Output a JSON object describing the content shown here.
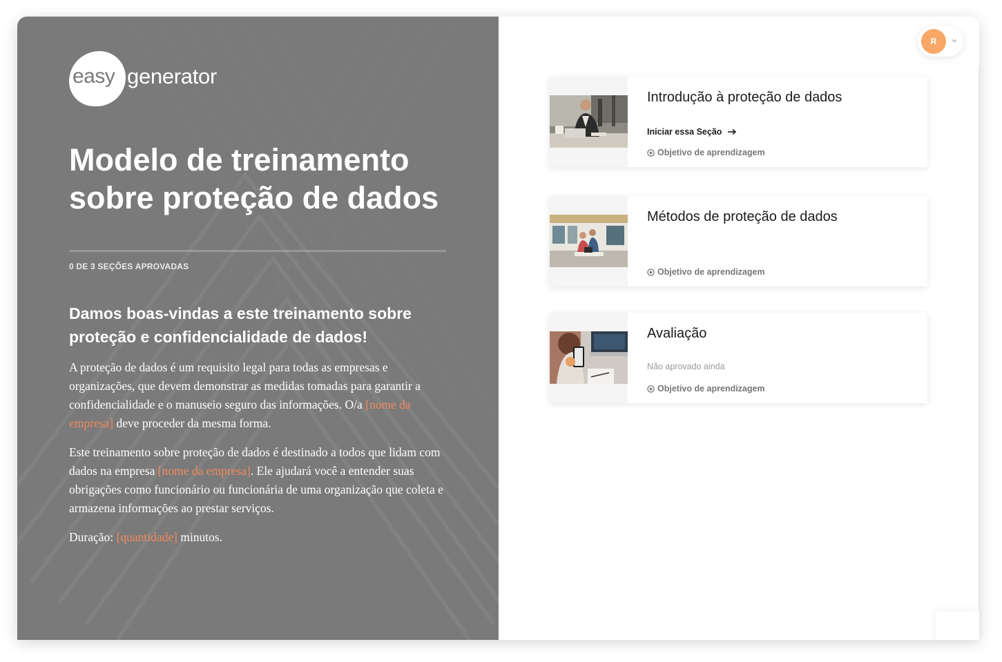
{
  "brand": {
    "logo_easy": "easy",
    "logo_generator": "generator"
  },
  "course": {
    "title": "Modelo de treinamento sobre proteção de dados",
    "progress_text": "0 DE 3 SEÇÕES APROVADAS",
    "progress_fraction": 0,
    "welcome_heading": "Damos boas-vindas a este treinamento sobre proteção e confidencialidade de dados!",
    "paragraphs": [
      [
        {
          "text": "A proteção de dados é um requisito legal para todas as empresas e organizações, que devem demonstrar as medidas tomadas para garantir a confidencialidade e o manuseio seguro das informações. O/a "
        },
        {
          "text": "[nome da empresa]",
          "highlight": true
        },
        {
          "text": " deve proceder da mesma forma."
        }
      ],
      [
        {
          "text": "Este treinamento sobre proteção de dados é destinado a todos que lidam com dados na empresa "
        },
        {
          "text": "[nome da empresa]",
          "highlight": true
        },
        {
          "text": ". Ele ajudará você a entender suas obrigações como funcionário ou funcionária de uma organização que coleta e armazena informações ao prestar serviços."
        }
      ],
      [
        {
          "text": "Duração: "
        },
        {
          "text": "[quantidade]",
          "highlight": true
        },
        {
          "text": " minutos."
        }
      ]
    ]
  },
  "user": {
    "initial": "R",
    "menu_icon": "chevron-down-icon"
  },
  "sections": [
    {
      "title": "Introdução à proteção de dados",
      "action": "Iniciar essa Seção",
      "action_icon": "arrow-right-icon",
      "objective": "Objetivo de aprendizagem",
      "image": "man-at-laptop-photo"
    },
    {
      "title": "Métodos de proteção de dados",
      "objective": "Objetivo de aprendizagem",
      "image": "office-meeting-photo"
    },
    {
      "title": "Avaliação",
      "status": "Não aprovado ainda",
      "objective": "Objetivo de aprendizagem",
      "image": "phone-and-laptop-photo"
    }
  ],
  "colors": {
    "panel": "#7a7a7a",
    "highlight": "#f08a5d",
    "avatar": "#f8a766",
    "text_dark": "#1b1b1b",
    "muted": "#9a9a9a"
  }
}
